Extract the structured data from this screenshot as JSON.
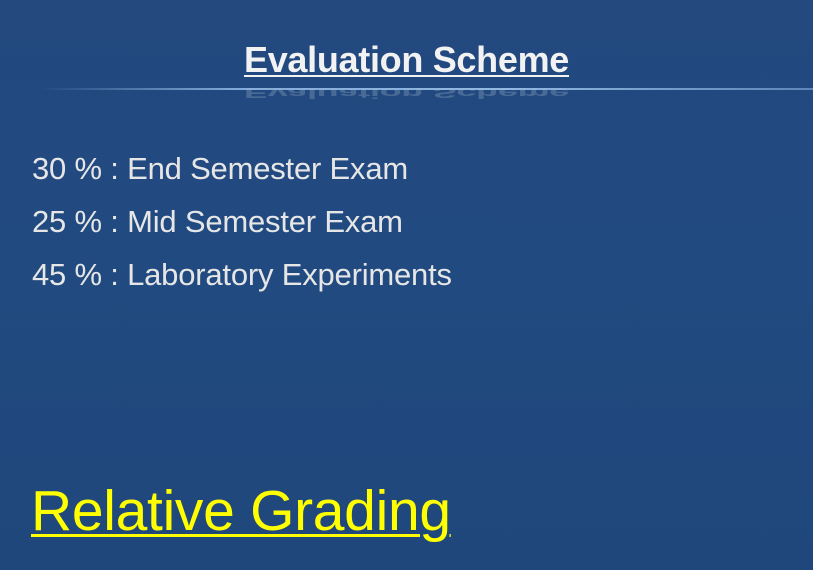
{
  "slide": {
    "title": "Evaluation Scheme",
    "items": [
      "30 % : End Semester Exam",
      "25 % : Mid Semester Exam",
      "45 % : Laboratory Experiments"
    ],
    "footer_heading": "Relative Grading"
  },
  "colors": {
    "background": "#214a80",
    "title_text": "#f2f2f2",
    "body_text": "#e6e6e6",
    "highlight_text": "#ffff00",
    "title_rule": "#8cb4e1"
  }
}
